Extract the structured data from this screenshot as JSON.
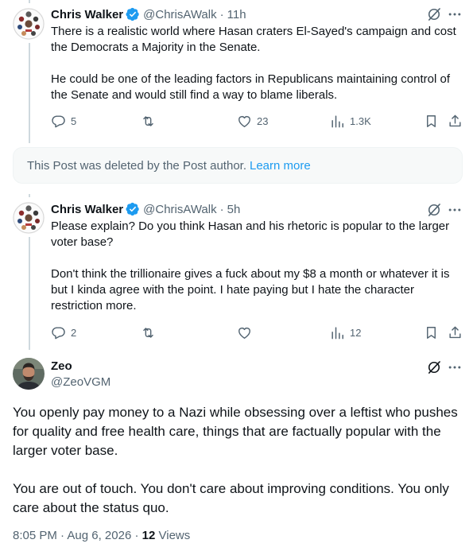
{
  "posts": [
    {
      "author": "Chris Walker",
      "handle": "@ChrisAWalk",
      "separator": "·",
      "time": "11h",
      "paragraphs": [
        "There is a realistic world where Hasan craters El-Sayed's campaign and cost the Democrats a Majority in the Senate.",
        "He could be one of the leading factors in Republicans maintaining control of the Senate and would still find a way to blame liberals."
      ],
      "replies": "5",
      "reposts": "",
      "likes": "23",
      "views": "1.3K"
    },
    {
      "author": "Chris Walker",
      "handle": "@ChrisAWalk",
      "separator": "·",
      "time": "5h",
      "paragraphs": [
        "Please explain? Do you think Hasan and his rhetoric is popular to the larger voter base?",
        "Don't think the trillionaire gives a fuck about my $8 a month or whatever it is but I kinda agree with the point. I hate paying but I hate the character restriction more."
      ],
      "replies": "2",
      "reposts": "",
      "likes": "",
      "views": "12"
    }
  ],
  "deleted_notice": {
    "text": "This Post was deleted by the Post author.",
    "link": "Learn more"
  },
  "main_post": {
    "author": "Zeo",
    "handle": "@ZeoVGM",
    "paragraphs": [
      "You openly pay money to a Nazi while obsessing over a leftist who pushes for quality and free health care, things that are factually popular with the larger voter base.",
      "You are out of touch. You don't care about improving conditions. You only care about the status quo."
    ],
    "time": "8:05 PM",
    "separator": "·",
    "date": "Aug 6, 2026",
    "views_count": "12",
    "views_label": "Views"
  },
  "colors": {
    "text": "#0f1419",
    "secondary": "#536471",
    "accent": "#1d9bf0",
    "thread_line": "#cfd9de"
  },
  "icons": [
    "verified-badge-icon",
    "grok-icon",
    "more-icon",
    "reply-icon",
    "repost-icon",
    "like-icon",
    "views-icon",
    "bookmark-icon",
    "share-icon"
  ]
}
